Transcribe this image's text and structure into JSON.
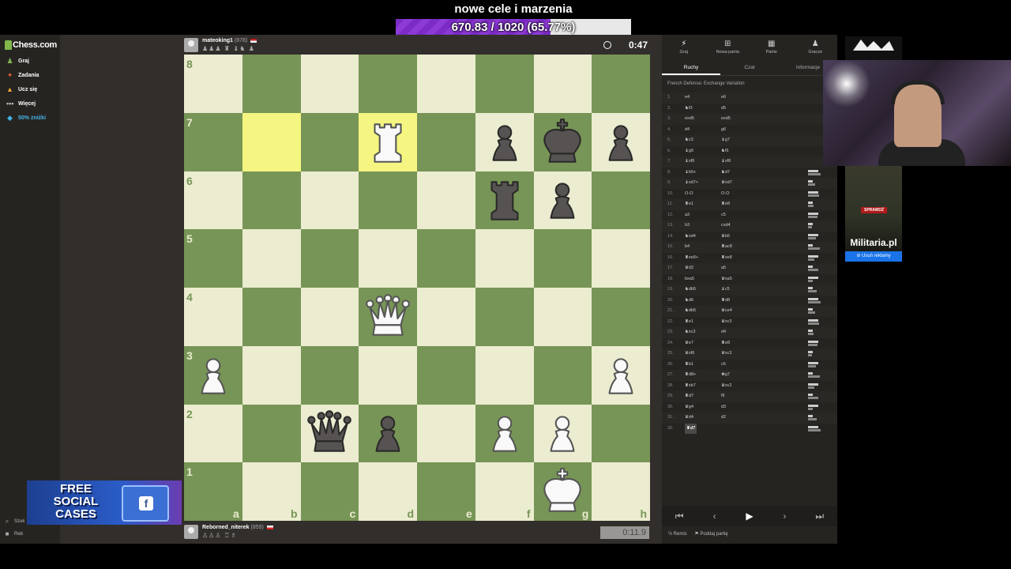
{
  "goal": {
    "title": "nowe cele i marzenia",
    "progress_text": "670.83 / 1020 (65.77%)",
    "progress_fraction": 0.6577
  },
  "sidebar": {
    "logo": "Chess.com",
    "items": [
      {
        "label": "Graj",
        "icon": "pawn-icon",
        "glyph": "♟"
      },
      {
        "label": "Zadania",
        "icon": "puzzle-icon",
        "glyph": "✦"
      },
      {
        "label": "Ucz się",
        "icon": "learn-icon",
        "glyph": "▲"
      },
      {
        "label": "Więcej",
        "icon": "more-icon",
        "glyph": "•••"
      },
      {
        "label": "50% zniżki",
        "icon": "diamond-icon",
        "glyph": "◆"
      }
    ],
    "bottom": [
      {
        "label": "Szuk",
        "icon": "search-icon",
        "glyph": "⌕"
      },
      {
        "label": "Reb",
        "icon": "user-icon",
        "glyph": "■"
      }
    ]
  },
  "top_player": {
    "name": "mateoking1",
    "rating": "(878)",
    "captures": "♟♟♟ ♜ ♝♞ ♟",
    "clock": "0:47"
  },
  "bottom_player": {
    "name": "Reborned_niterek",
    "rating": "(859)",
    "captures": "♙♙♙ ♖♗",
    "clock": "0:11.9"
  },
  "board": {
    "files": [
      "a",
      "b",
      "c",
      "d",
      "e",
      "f",
      "g",
      "h"
    ],
    "ranks": [
      "8",
      "7",
      "6",
      "5",
      "4",
      "3",
      "2",
      "1"
    ],
    "highlight": [
      "b7",
      "d7"
    ],
    "pieces": [
      {
        "sq": "d7",
        "color": "w",
        "type": "R"
      },
      {
        "sq": "f7",
        "color": "b",
        "type": "P"
      },
      {
        "sq": "g7",
        "color": "b",
        "type": "K"
      },
      {
        "sq": "h7",
        "color": "b",
        "type": "P"
      },
      {
        "sq": "f6",
        "color": "b",
        "type": "R"
      },
      {
        "sq": "g6",
        "color": "b",
        "type": "P"
      },
      {
        "sq": "d4",
        "color": "w",
        "type": "Q"
      },
      {
        "sq": "a3",
        "color": "w",
        "type": "P"
      },
      {
        "sq": "h3",
        "color": "w",
        "type": "P"
      },
      {
        "sq": "c2",
        "color": "b",
        "type": "Q"
      },
      {
        "sq": "d2",
        "color": "b",
        "type": "P"
      },
      {
        "sq": "f2",
        "color": "w",
        "type": "P"
      },
      {
        "sq": "g2",
        "color": "w",
        "type": "P"
      },
      {
        "sq": "g1",
        "color": "w",
        "type": "K"
      }
    ]
  },
  "panel": {
    "tabs": [
      {
        "label": "Graj",
        "icon": "play-icon",
        "glyph": "⚡"
      },
      {
        "label": "Nowa partia",
        "icon": "new-game-icon",
        "glyph": "⊞"
      },
      {
        "label": "Partie",
        "icon": "games-icon",
        "glyph": "▦"
      },
      {
        "label": "Gracze",
        "icon": "players-icon",
        "glyph": "♟"
      }
    ],
    "subtabs": [
      "Ruchy",
      "Czat",
      "Informacje"
    ],
    "opening": "French Defense: Exchange Variation",
    "moves": [
      [
        "1.",
        "e4",
        "e6"
      ],
      [
        "2.",
        "♞f3",
        "d5"
      ],
      [
        "3.",
        "exd5",
        "exd5"
      ],
      [
        "4.",
        "d4",
        "g6"
      ],
      [
        "5.",
        "♞c3",
        "♝g7"
      ],
      [
        "6.",
        "♝g5",
        "♞f6"
      ],
      [
        "7.",
        "♝xf6",
        "♝xf6"
      ],
      [
        "8.",
        "♝b5+",
        "♞d7"
      ],
      [
        "9.",
        "♝xd7+",
        "♛xd7"
      ],
      [
        "10.",
        "O-O",
        "O-O"
      ],
      [
        "11.",
        "♜e1",
        "♜e8"
      ],
      [
        "12.",
        "a3",
        "c5"
      ],
      [
        "13.",
        "h3",
        "cxd4"
      ],
      [
        "14.",
        "♞xd4",
        "♛b6"
      ],
      [
        "15.",
        "b4",
        "♜ac8"
      ],
      [
        "16.",
        "♜xe8+",
        "♜xe8"
      ],
      [
        "17.",
        "♛d2",
        "a5"
      ],
      [
        "18.",
        "bxa5",
        "♛xa5"
      ],
      [
        "19.",
        "♞db5",
        "♝c5"
      ],
      [
        "20.",
        "♞d6",
        "♜d8"
      ],
      [
        "21.",
        "♞db5",
        "♛ce4"
      ],
      [
        "22.",
        "♜e1",
        "♛xc3"
      ],
      [
        "23.",
        "♞xc3",
        "d4"
      ],
      [
        "24.",
        "♛e7",
        "♜e8"
      ],
      [
        "25.",
        "♛xf6",
        "♛xc3"
      ],
      [
        "26.",
        "♜b1",
        "c6"
      ],
      [
        "27.",
        "♜d8+",
        "♚g7"
      ],
      [
        "28.",
        "♜xb7",
        "♛xc2"
      ],
      [
        "29.",
        "♜d7",
        "f6"
      ],
      [
        "30.",
        "♛g4",
        "d3"
      ],
      [
        "31.",
        "♛d4",
        "d2"
      ],
      [
        "32.",
        "♜d7",
        ""
      ]
    ],
    "controls": [
      {
        "name": "first-move-button",
        "glyph": "⏮"
      },
      {
        "name": "prev-move-button",
        "glyph": "‹"
      },
      {
        "name": "play-button",
        "glyph": "▶"
      },
      {
        "name": "next-move-button",
        "glyph": "›"
      },
      {
        "name": "last-move-button",
        "glyph": "⏭"
      }
    ],
    "footer": {
      "draw": "½ Remis",
      "resign": "⚑ Poddaj partię"
    }
  },
  "ads": {
    "side_tag": "SPRAWDŹ",
    "side_name": "Militaria.pl",
    "remove": "⊘ Usuń reklamy",
    "promo": "FREE SOCIAL CASES"
  },
  "colors": {
    "light_square": "#ebecd0",
    "dark_square": "#779556",
    "highlight": "#f5f682",
    "goal_fill": "#7b2cc4"
  }
}
